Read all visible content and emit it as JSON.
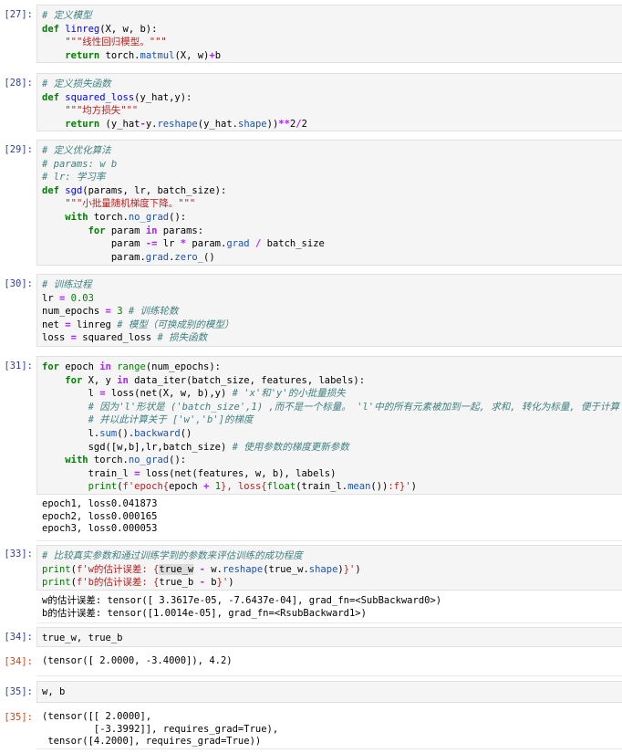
{
  "cells": [
    {
      "prompt_in": "[27]:",
      "lines": [
        [
          {
            "t": "# 定义模型",
            "c": "c"
          }
        ],
        [
          {
            "t": "def",
            "c": "k"
          },
          {
            "t": " "
          },
          {
            "t": "linreg",
            "c": "f"
          },
          {
            "t": "(X, w, b):"
          }
        ],
        [
          {
            "t": "    "
          },
          {
            "t": "\"\"\"线性回归模型。\"\"\"",
            "c": "s"
          }
        ],
        [
          {
            "t": "    "
          },
          {
            "t": "return",
            "c": "k"
          },
          {
            "t": " torch."
          },
          {
            "t": "matmul",
            "c": "a"
          },
          {
            "t": "(X, w)"
          },
          {
            "t": "+",
            "c": "o"
          },
          {
            "t": "b"
          }
        ]
      ]
    },
    {
      "prompt_in": "[28]:",
      "lines": [
        [
          {
            "t": "# 定义损失函数",
            "c": "c"
          }
        ],
        [
          {
            "t": "def",
            "c": "k"
          },
          {
            "t": " "
          },
          {
            "t": "squared_loss",
            "c": "f"
          },
          {
            "t": "(y_hat,y):"
          }
        ],
        [
          {
            "t": "    "
          },
          {
            "t": "\"\"\"均方损失\"\"\"",
            "c": "s"
          }
        ],
        [
          {
            "t": "    "
          },
          {
            "t": "return",
            "c": "k"
          },
          {
            "t": " (y_hat"
          },
          {
            "t": "-",
            "c": "o"
          },
          {
            "t": "y."
          },
          {
            "t": "reshape",
            "c": "a"
          },
          {
            "t": "(y_hat."
          },
          {
            "t": "shape",
            "c": "a"
          },
          {
            "t": "))"
          },
          {
            "t": "**",
            "c": "o"
          },
          {
            "t": "2"
          },
          {
            "t": "/",
            "c": "o"
          },
          {
            "t": "2"
          }
        ]
      ]
    },
    {
      "prompt_in": "[29]:",
      "lines": [
        [
          {
            "t": "# 定义优化算法",
            "c": "c"
          }
        ],
        [
          {
            "t": "# params: w b",
            "c": "c"
          }
        ],
        [
          {
            "t": "# lr: 学习率",
            "c": "c"
          }
        ],
        [
          {
            "t": "def",
            "c": "k"
          },
          {
            "t": " "
          },
          {
            "t": "sgd",
            "c": "f"
          },
          {
            "t": "(params, lr, batch_size):"
          }
        ],
        [
          {
            "t": "    "
          },
          {
            "t": "\"\"\"小批量随机梯度下降。\"\"\"",
            "c": "s"
          }
        ],
        [
          {
            "t": "    "
          },
          {
            "t": "with",
            "c": "k"
          },
          {
            "t": " torch."
          },
          {
            "t": "no_grad",
            "c": "a"
          },
          {
            "t": "():"
          }
        ],
        [
          {
            "t": "        "
          },
          {
            "t": "for",
            "c": "k"
          },
          {
            "t": " param "
          },
          {
            "t": "in",
            "c": "o"
          },
          {
            "t": " params:"
          }
        ],
        [
          {
            "t": "            param "
          },
          {
            "t": "-=",
            "c": "o"
          },
          {
            "t": " lr "
          },
          {
            "t": "*",
            "c": "o"
          },
          {
            "t": " param."
          },
          {
            "t": "grad",
            "c": "a"
          },
          {
            "t": " "
          },
          {
            "t": "/",
            "c": "o"
          },
          {
            "t": " batch_size"
          }
        ],
        [
          {
            "t": "            param."
          },
          {
            "t": "grad",
            "c": "a"
          },
          {
            "t": "."
          },
          {
            "t": "zero_",
            "c": "a"
          },
          {
            "t": "()"
          }
        ]
      ]
    },
    {
      "prompt_in": "[30]:",
      "lines": [
        [
          {
            "t": "# 训练过程",
            "c": "c"
          }
        ],
        [
          {
            "t": "lr "
          },
          {
            "t": "=",
            "c": "o"
          },
          {
            "t": " "
          },
          {
            "t": "0.03",
            "c": "n"
          }
        ],
        [
          {
            "t": "num_epochs "
          },
          {
            "t": "=",
            "c": "o"
          },
          {
            "t": " "
          },
          {
            "t": "3",
            "c": "n"
          },
          {
            "t": " "
          },
          {
            "t": "# 训练轮数",
            "c": "c"
          }
        ],
        [
          {
            "t": "net "
          },
          {
            "t": "=",
            "c": "o"
          },
          {
            "t": " linreg "
          },
          {
            "t": "# 模型（可换成别的模型）",
            "c": "c"
          }
        ],
        [
          {
            "t": "loss "
          },
          {
            "t": "=",
            "c": "o"
          },
          {
            "t": " squared_loss "
          },
          {
            "t": "# 损失函数",
            "c": "c"
          }
        ]
      ]
    },
    {
      "prompt_in": "[31]:",
      "lines": [
        [
          {
            "t": "for",
            "c": "k"
          },
          {
            "t": " epoch "
          },
          {
            "t": "in",
            "c": "o"
          },
          {
            "t": " "
          },
          {
            "t": "range",
            "c": "b"
          },
          {
            "t": "(num_epochs):"
          }
        ],
        [
          {
            "t": "    "
          },
          {
            "t": "for",
            "c": "k"
          },
          {
            "t": " X, y "
          },
          {
            "t": "in",
            "c": "o"
          },
          {
            "t": " data_iter(batch_size, features, labels):"
          }
        ],
        [
          {
            "t": "        l "
          },
          {
            "t": "=",
            "c": "o"
          },
          {
            "t": " loss(net(X, w, b),y) "
          },
          {
            "t": "# 'x'和'y'的小批量损失",
            "c": "c"
          }
        ],
        [
          {
            "t": "        "
          },
          {
            "t": "# 因为'l'形状是 ('batch_size',1) ,而不是一个标量。 'l'中的所有元素被加到一起, 求和, 转化为标量, 便于计算",
            "c": "c"
          }
        ],
        [
          {
            "t": "        "
          },
          {
            "t": "# 并以此计算关于 ['w','b']的梯度",
            "c": "c"
          }
        ],
        [
          {
            "t": "        l."
          },
          {
            "t": "sum",
            "c": "a"
          },
          {
            "t": "()."
          },
          {
            "t": "backward",
            "c": "a"
          },
          {
            "t": "()"
          }
        ],
        [
          {
            "t": "        sgd([w,b],lr,batch_size) "
          },
          {
            "t": "# 使用参数的梯度更新参数",
            "c": "c"
          }
        ],
        [
          {
            "t": "    "
          },
          {
            "t": "with",
            "c": "k"
          },
          {
            "t": " torch."
          },
          {
            "t": "no_grad",
            "c": "a"
          },
          {
            "t": "():"
          }
        ],
        [
          {
            "t": "        train_l "
          },
          {
            "t": "=",
            "c": "o"
          },
          {
            "t": " loss(net(features, w, b), labels)"
          }
        ],
        [
          {
            "t": "        "
          },
          {
            "t": "print",
            "c": "b"
          },
          {
            "t": "(",
            "c": ""
          },
          {
            "t": "f'epoch{",
            "c": "s"
          },
          {
            "t": "epoch "
          },
          {
            "t": "+",
            "c": "o"
          },
          {
            "t": " "
          },
          {
            "t": "1",
            "c": "n"
          },
          {
            "t": "}, loss{",
            "c": "s"
          },
          {
            "t": "float",
            "c": "b"
          },
          {
            "t": "(train_l."
          },
          {
            "t": "mean",
            "c": "a"
          },
          {
            "t": "())"
          },
          {
            "t": ":f}'",
            "c": "s"
          },
          {
            "t": ")"
          }
        ]
      ],
      "output": "epoch1, loss0.041873\nepoch2, loss0.000165\nepoch3, loss0.000053"
    },
    {
      "prompt_in": "[33]:",
      "lines": [
        [
          {
            "t": "# 比较真实参数和通过训练学到的参数来评估训练的成功程度",
            "c": "c"
          }
        ],
        [
          {
            "t": "print",
            "c": "b"
          },
          {
            "t": "(",
            "c": ""
          },
          {
            "t": "f'w的估计误差: {",
            "c": "s"
          },
          {
            "t": "true_w",
            "c": "hl"
          },
          {
            "t": " "
          },
          {
            "t": "-",
            "c": "o"
          },
          {
            "t": " w."
          },
          {
            "t": "reshape",
            "c": "a"
          },
          {
            "t": "(true_w."
          },
          {
            "t": "shape",
            "c": "a"
          },
          {
            "t": ")"
          },
          {
            "t": "}'",
            "c": "s"
          },
          {
            "t": ")"
          }
        ],
        [
          {
            "t": "print",
            "c": "b"
          },
          {
            "t": "(",
            "c": ""
          },
          {
            "t": "f'b的估计误差: {",
            "c": "s"
          },
          {
            "t": "true_b "
          },
          {
            "t": "-",
            "c": "o"
          },
          {
            "t": " b"
          },
          {
            "t": "}'",
            "c": "s"
          },
          {
            "t": ")"
          }
        ]
      ],
      "output": "w的估计误差: tensor([ 3.3617e-05, -7.6437e-04], grad_fn=<SubBackward0>)\nb的估计误差: tensor([1.0014e-05], grad_fn=<RsubBackward1>)"
    },
    {
      "prompt_in": "[34]:",
      "lines": [
        [
          {
            "t": "true_w, true_b"
          }
        ]
      ],
      "prompt_out": "[34]:",
      "output": "(tensor([ 2.0000, -3.4000]), 4.2)"
    },
    {
      "prompt_in": "[35]:",
      "lines": [
        [
          {
            "t": "w, b"
          }
        ]
      ],
      "prompt_out": "[35]:",
      "output": "(tensor([[ 2.0000],\n         [-3.3992]], requires_grad=True),\n tensor([4.2000], requires_grad=True))"
    }
  ]
}
